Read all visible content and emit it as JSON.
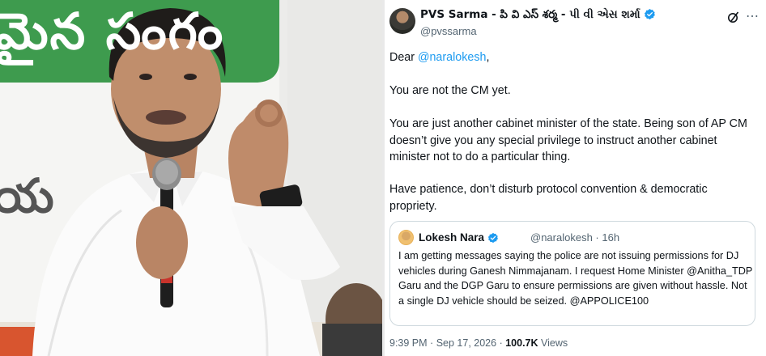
{
  "photo": {
    "banner_text_top": "మైన సంగం",
    "banner_text_mid": "య"
  },
  "tweet": {
    "author_name": "PVS Sarma - పి వి ఎస్ శర్మ - પી વી એસ શર્મા",
    "author_handle": "@pvssarma",
    "greeting_prefix": "Dear ",
    "greeting_mention": "@naralokesh",
    "greeting_suffix": ",",
    "paragraph_1": "You are not the CM yet.",
    "paragraph_2": "You are just another cabinet minister of the state. Being son of AP CM doesn’t give you any special privilege to instruct another cabinet minister not to do a particular thing.",
    "paragraph_3": "Have patience, don’t disturb protocol convention & democratic propriety.",
    "quoted": {
      "author_name": "Lokesh Nara",
      "author_handle": "@naralokesh",
      "separator": "·",
      "age": "16h",
      "text": "I am getting messages saying the police are not issuing permissions for DJ vehicles during Ganesh Nimmajanam. I request Home Minister @Anitha_TDP Garu and the DGP Garu to ensure permissions are given without hassle. Not a single DJ vehicle should be seized. @APPOLICE100"
    },
    "footer": {
      "time": "9:39 PM",
      "separator": "·",
      "date": "Sep 17, 2026",
      "views_count": "100.7K",
      "views_label": "Views"
    },
    "colors": {
      "link": "#1d9bf0",
      "verified": "#1d9bf0",
      "secondary_text": "#536471"
    }
  }
}
